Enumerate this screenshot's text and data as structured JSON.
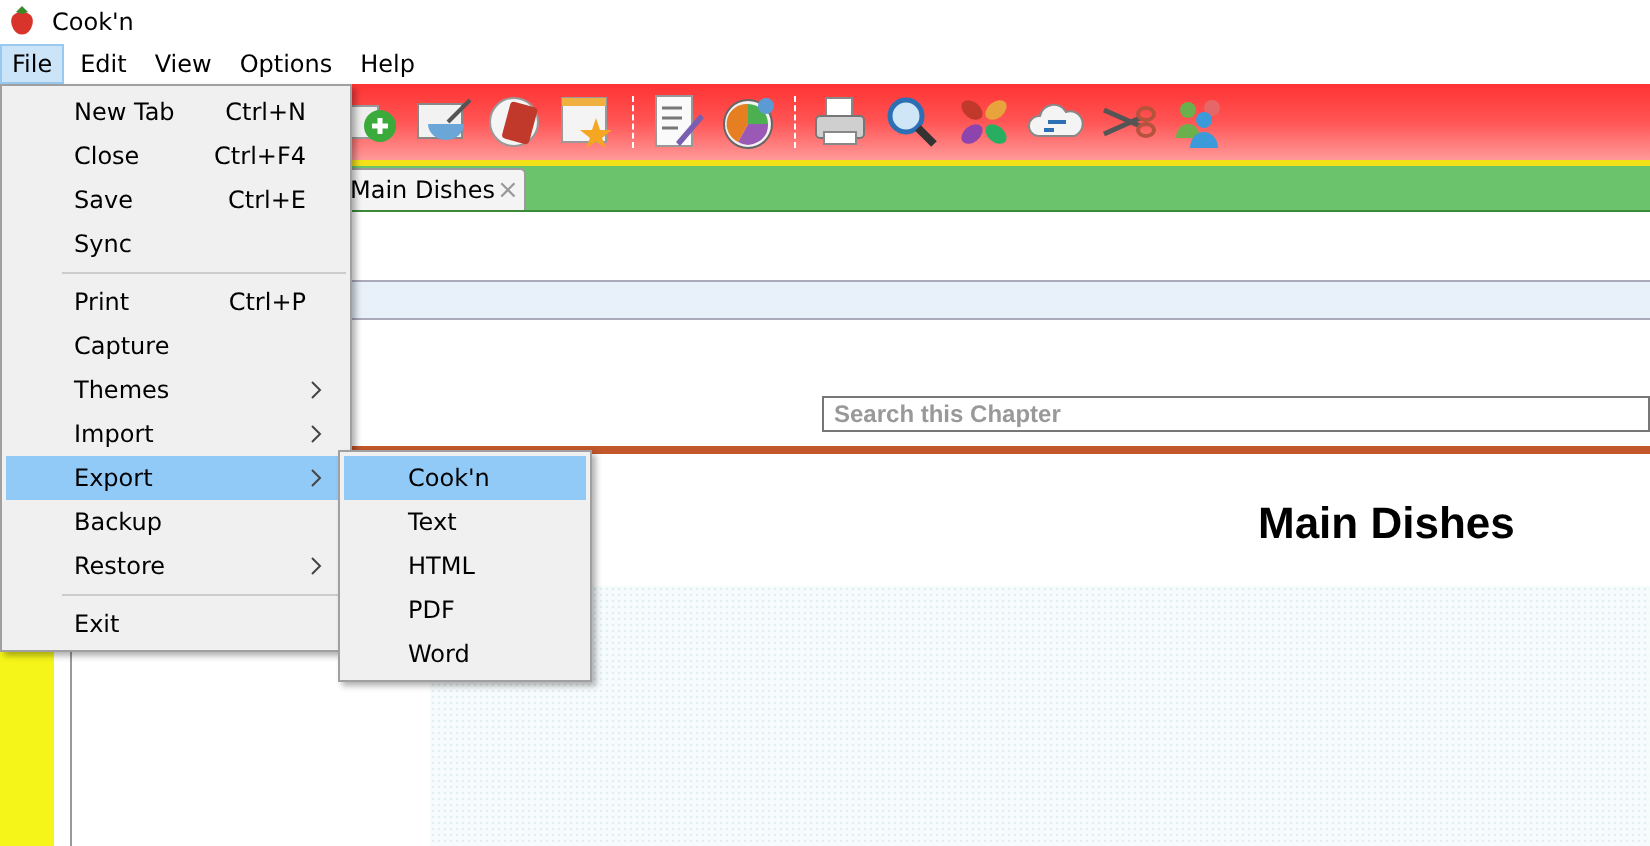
{
  "window": {
    "title": "Cook'n"
  },
  "menubar": [
    {
      "label": "File",
      "selected": true
    },
    {
      "label": "Edit",
      "selected": false
    },
    {
      "label": "View",
      "selected": false
    },
    {
      "label": "Options",
      "selected": false
    },
    {
      "label": "Help",
      "selected": false
    }
  ],
  "tab": {
    "label": "Main Dishes",
    "close": "×"
  },
  "search": {
    "placeholder": "Search this Chapter"
  },
  "heading": "Main Dishes",
  "file_menu": [
    {
      "kind": "item",
      "label": "New Tab",
      "shortcut": "Ctrl+N",
      "submenu": false,
      "selected": false
    },
    {
      "kind": "item",
      "label": "Close",
      "shortcut": "Ctrl+F4",
      "submenu": false,
      "selected": false
    },
    {
      "kind": "item",
      "label": "Save",
      "shortcut": "Ctrl+E",
      "submenu": false,
      "selected": false
    },
    {
      "kind": "item",
      "label": "Sync",
      "submenu": false,
      "selected": false
    },
    {
      "kind": "separator"
    },
    {
      "kind": "item",
      "label": "Print",
      "shortcut": "Ctrl+P",
      "submenu": false,
      "selected": false
    },
    {
      "kind": "item",
      "label": "Capture",
      "submenu": false,
      "selected": false
    },
    {
      "kind": "item",
      "label": "Themes",
      "submenu": true,
      "selected": false
    },
    {
      "kind": "item",
      "label": "Import",
      "submenu": true,
      "selected": false
    },
    {
      "kind": "item",
      "label": "Export",
      "submenu": true,
      "selected": true
    },
    {
      "kind": "item",
      "label": "Backup",
      "submenu": false,
      "selected": false
    },
    {
      "kind": "item",
      "label": "Restore",
      "submenu": true,
      "selected": false
    },
    {
      "kind": "separator"
    },
    {
      "kind": "item",
      "label": "Exit",
      "submenu": false,
      "selected": false
    }
  ],
  "export_menu": [
    {
      "label": "Cook'n",
      "selected": true
    },
    {
      "label": "Text",
      "selected": false
    },
    {
      "label": "HTML",
      "selected": false
    },
    {
      "label": "PDF",
      "selected": false
    },
    {
      "label": "Word",
      "selected": false
    }
  ]
}
